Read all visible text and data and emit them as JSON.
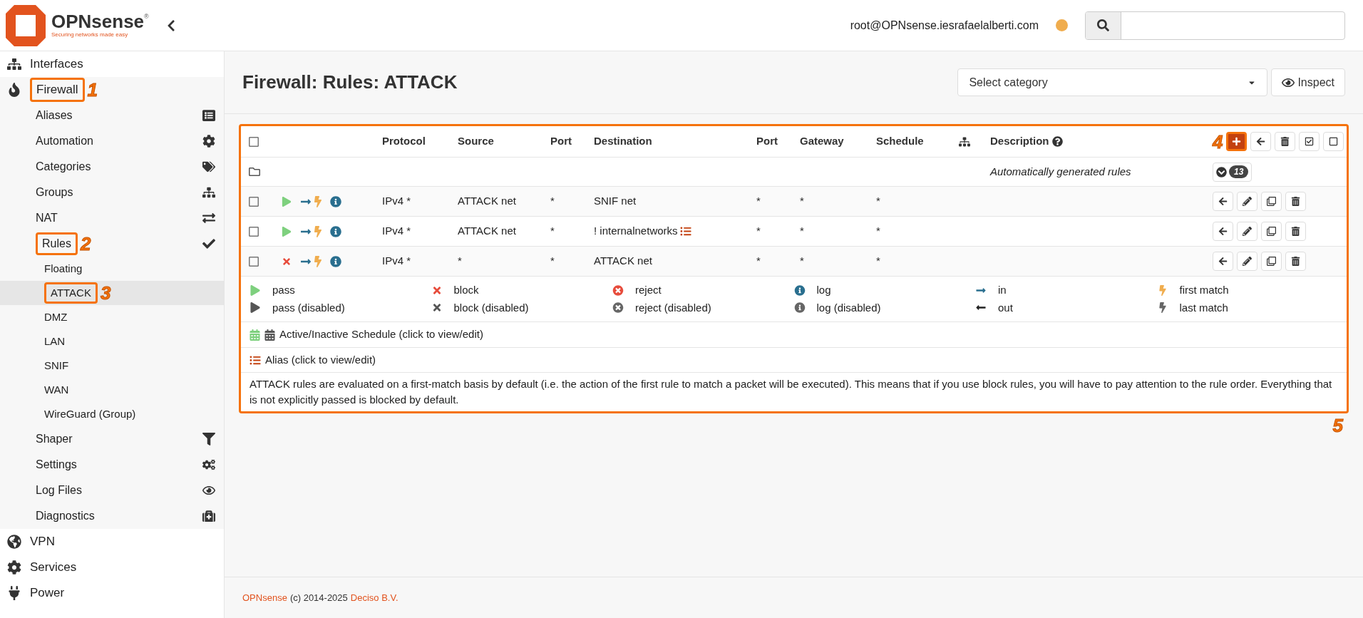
{
  "logo": {
    "name": "OPNsense",
    "mark": "®",
    "tagline": "Securing networks made easy"
  },
  "header": {
    "user": "root@OPNsense.iesrafaelalberti.com"
  },
  "sidebar": {
    "items": [
      {
        "label": "Interfaces"
      },
      {
        "label": "Firewall",
        "expanded": true,
        "annotation": "1",
        "children": [
          {
            "label": "Aliases"
          },
          {
            "label": "Automation"
          },
          {
            "label": "Categories"
          },
          {
            "label": "Groups"
          },
          {
            "label": "NAT"
          },
          {
            "label": "Rules",
            "expanded": true,
            "annotation": "2",
            "children": [
              {
                "label": "Floating",
                "selected": false
              },
              {
                "label": "ATTACK",
                "selected": true,
                "annotation": "3"
              },
              {
                "label": "DMZ",
                "selected": false
              },
              {
                "label": "LAN",
                "selected": false
              },
              {
                "label": "SNIF",
                "selected": false
              },
              {
                "label": "WAN",
                "selected": false
              },
              {
                "label": "WireGuard (Group)",
                "selected": false
              }
            ]
          },
          {
            "label": "Shaper"
          },
          {
            "label": "Settings"
          },
          {
            "label": "Log Files"
          },
          {
            "label": "Diagnostics"
          }
        ]
      },
      {
        "label": "VPN"
      },
      {
        "label": "Services"
      },
      {
        "label": "Power"
      }
    ]
  },
  "page": {
    "title": "Firewall: Rules: ATTACK",
    "category_placeholder": "Select category",
    "inspect": "Inspect"
  },
  "table": {
    "annotation": "5",
    "header_annotation": "4",
    "all_checked": false,
    "columns": [
      "Protocol",
      "Source",
      "Port",
      "Destination",
      "Port",
      "Gateway",
      "Schedule",
      "Description"
    ],
    "group": {
      "description": "Automatically generated rules",
      "count": "13"
    },
    "rows": [
      {
        "checked": false,
        "kind": "pass",
        "protocol": "IPv4 *",
        "source": "ATTACK net",
        "source_port": "*",
        "destination": "SNIF net",
        "destination_alias": false,
        "destination_port": "*",
        "gateway": "*",
        "schedule": "*"
      },
      {
        "checked": false,
        "kind": "pass",
        "protocol": "IPv4 *",
        "source": "ATTACK net",
        "source_port": "*",
        "destination": "! internalnetworks",
        "destination_alias": true,
        "destination_port": "*",
        "gateway": "*",
        "schedule": "*"
      },
      {
        "checked": false,
        "kind": "block",
        "protocol": "IPv4 *",
        "source": "*",
        "source_port": "*",
        "destination": "ATTACK net",
        "destination_alias": false,
        "destination_port": "*",
        "gateway": "*",
        "schedule": "*"
      }
    ]
  },
  "legend": {
    "items": [
      {
        "kind": "pass",
        "label": "pass"
      },
      {
        "kind": "block",
        "label": "block"
      },
      {
        "kind": "reject",
        "label": "reject"
      },
      {
        "kind": "log",
        "label": "log"
      },
      {
        "kind": "in",
        "label": "in"
      },
      {
        "kind": "first",
        "label": "first match"
      },
      {
        "kind": "pass_disabled",
        "label": "pass (disabled)"
      },
      {
        "kind": "block_disabled",
        "label": "block (disabled)"
      },
      {
        "kind": "reject_disabled",
        "label": "reject (disabled)"
      },
      {
        "kind": "log_disabled",
        "label": "log (disabled)"
      },
      {
        "kind": "out",
        "label": "out"
      },
      {
        "kind": "last",
        "label": "last match"
      }
    ],
    "schedule": "Active/Inactive Schedule (click to view/edit)",
    "alias": "Alias (click to view/edit)",
    "note": "ATTACK rules are evaluated on a first-match basis by default (i.e. the action of the first rule to match a packet will be executed). This means that if you use block rules, you will have to pay attention to the rule order. Everything that is not explicitly passed is blocked by default."
  },
  "footer": {
    "brand": "OPNsense",
    "copyright": "(c) 2014-2025",
    "company": "Deciso B.V."
  }
}
